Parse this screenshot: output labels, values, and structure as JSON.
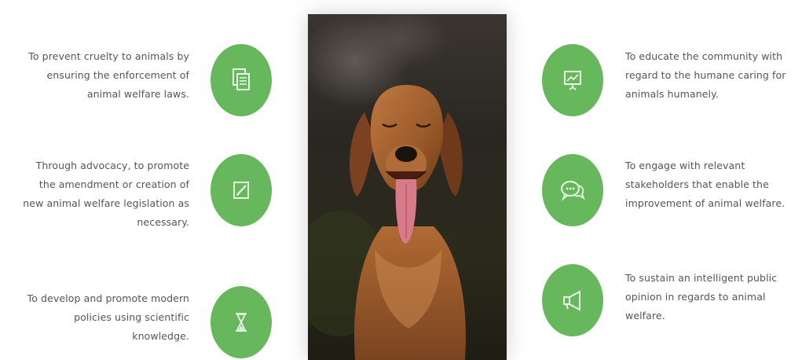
{
  "goals": {
    "left": [
      {
        "icon": "documents-icon",
        "lines": [
          "To prevent cruelty to animals by",
          "ensuring the enforcement of",
          "animal welfare laws."
        ]
      },
      {
        "icon": "pencil-note-icon",
        "lines": [
          "Through advocacy, to promote",
          "the amendment or creation of",
          "new animal welfare legislation as",
          "necessary."
        ]
      },
      {
        "icon": "hourglass-icon",
        "lines": [
          "To develop and promote modern",
          "policies using scientific",
          "knowledge."
        ]
      }
    ],
    "right": [
      {
        "icon": "presentation-board-icon",
        "lines": [
          "To educate the community with",
          "regard to the humane caring for",
          "animals humanely."
        ]
      },
      {
        "icon": "chat-bubbles-icon",
        "lines": [
          "To engage with relevant",
          "stakeholders that enable the",
          "improvement of animal welfare."
        ]
      },
      {
        "icon": "megaphone-icon",
        "lines": [
          "To sustain an intelligent public",
          "opinion in regards to animal",
          "welfare."
        ]
      }
    ]
  },
  "colors": {
    "accent": "#67b85c",
    "text": "#555555"
  }
}
